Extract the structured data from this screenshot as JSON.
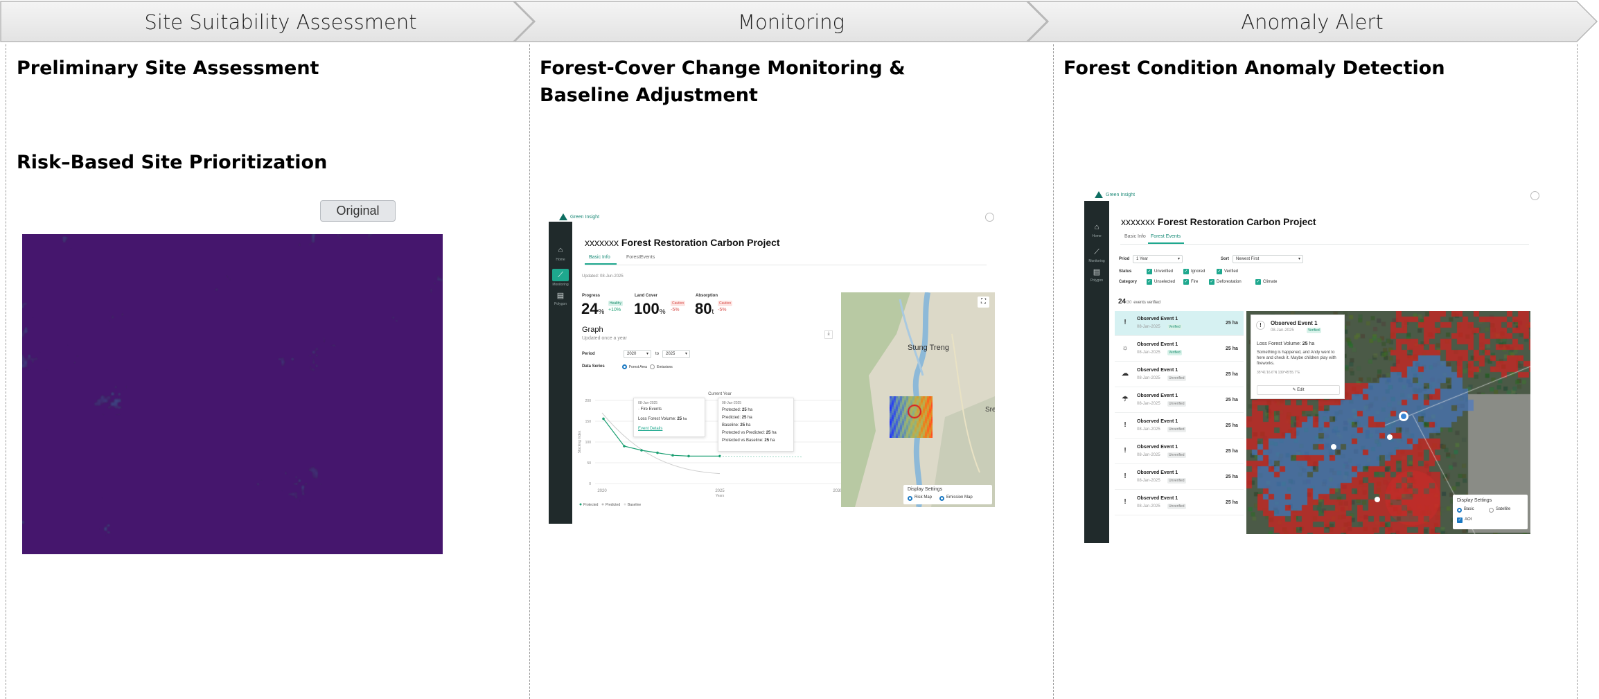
{
  "steps": [
    {
      "label": "Site Suitability Assessment"
    },
    {
      "label": "Monitoring"
    },
    {
      "label": "Anomaly Alert"
    }
  ],
  "col1": {
    "title1": "Preliminary Site Assessment",
    "title2": "Risk–Based Site Prioritization",
    "original_button": "Original"
  },
  "col2": {
    "title": "Forest-Cover Change Monitoring & Baseline Adjustment",
    "app": {
      "brand": "Green Insight",
      "nav": [
        {
          "label": "Home",
          "icon": "home-icon"
        },
        {
          "label": "Monitoring",
          "icon": "chart-icon"
        },
        {
          "label": "Polygon",
          "icon": "layers-icon"
        }
      ],
      "project_title_prefix": "xxxxxxx",
      "project_title": "Forest Restoration Carbon Project",
      "tabs": [
        "Basic Info",
        "ForestEvents"
      ],
      "updated": "Updated: 08-Jun-2025",
      "metrics": [
        {
          "label": "Progress",
          "value": "24",
          "unit": "%",
          "badge": "Healthy",
          "delta": "+10%",
          "tone": "green"
        },
        {
          "label": "Land Cover",
          "value": "100",
          "unit": "%",
          "badge": "Caution",
          "delta": "-5%",
          "tone": "red"
        },
        {
          "label": "Absorption",
          "value": "80",
          "unit": "t",
          "badge": "Caution",
          "delta": "-5%",
          "tone": "red"
        }
      ],
      "graph_title": "Graph",
      "graph_subtitle": "Updated once a year",
      "period_label": "Period",
      "period_from": "2020",
      "period_to_label": "to",
      "period_to": "2025",
      "data_series_label": "Data Series",
      "series_options": [
        "Forest Area",
        "Emissions"
      ],
      "chart_label_current": "Current Year",
      "y_axis_label": "Stocking Index",
      "x_axis_label": "Years",
      "y_ticks": [
        "200",
        "150",
        "100",
        "50",
        "0"
      ],
      "x_ticks": [
        "2020",
        "2025",
        "2030"
      ],
      "legend": [
        "Protected",
        "Predicted",
        "Baseline"
      ],
      "tooltip1": {
        "date": "08-Jan-2025",
        "event": "Fire Events",
        "volume_label": "Loss Forest Volume:",
        "volume_value": "25",
        "volume_unit": "ha",
        "link": "Event Details"
      },
      "tooltip2": {
        "date": "08-Jan-2025",
        "rows": [
          {
            "label": "Protected:",
            "value": "25",
            "unit": "ha"
          },
          {
            "label": "Predicted:",
            "value": "25",
            "unit": "ha"
          },
          {
            "label": "Baseline:",
            "value": "25",
            "unit": "ha"
          },
          {
            "label": "Protected vs Predicted:",
            "value": "25",
            "unit": "ha"
          },
          {
            "label": "Protected vs Baseline:",
            "value": "25",
            "unit": "ha"
          }
        ]
      },
      "map_label_town": "Stung Treng",
      "map_label_edge": "Sre",
      "display_settings": "Display Settings",
      "map_options": [
        "Risk Map",
        "Emission Map"
      ]
    }
  },
  "col3": {
    "title": "Forest Condition Anomaly Detection",
    "app": {
      "brand": "Green Insight",
      "nav": [
        {
          "label": "Home",
          "icon": "home-icon"
        },
        {
          "label": "Monitoring",
          "icon": "chart-icon"
        },
        {
          "label": "Polygon",
          "icon": "layers-icon"
        }
      ],
      "project_title_prefix": "xxxxxxx",
      "project_title": "Forest Restoration Carbon Project",
      "tabs": [
        "Basic Info",
        "Forest Events"
      ],
      "period_label": "Priod",
      "period_value": "1 Year",
      "sort_label": "Sort",
      "sort_value": "Newest First",
      "status_label": "Status",
      "status_options": [
        "Unverified",
        "Ignored",
        "Verified"
      ],
      "category_label": "Category",
      "category_options": [
        "Unselected",
        "Fire",
        "Deforestation",
        "Climate"
      ],
      "count_value": "24",
      "count_total": "/30",
      "count_suffix": "events verified",
      "events": [
        {
          "title": "Observed Event 1",
          "date": "08-Jan-2025",
          "status": "Verified",
          "value": "25 ha",
          "icon": "!",
          "icon_name": "alert-icon"
        },
        {
          "title": "Observed Event 1",
          "date": "08-Jan-2025",
          "status": "Verified",
          "value": "25 ha",
          "icon": "☼",
          "icon_name": "fire-icon"
        },
        {
          "title": "Observed Event 1",
          "date": "08-Jan-2025",
          "status": "Unverified",
          "value": "25 ha",
          "icon": "☁",
          "icon_name": "cloud-icon"
        },
        {
          "title": "Observed Event 1",
          "date": "08-Jan-2025",
          "status": "Unverified",
          "value": "25 ha",
          "icon": "☂",
          "icon_name": "storm-icon"
        },
        {
          "title": "Observed Event 1",
          "date": "08-Jan-2025",
          "status": "Unverified",
          "value": "25 ha",
          "icon": "!",
          "icon_name": "alert-icon"
        },
        {
          "title": "Observed Event 1",
          "date": "08-Jan-2025",
          "status": "Unverified",
          "value": "25 ha",
          "icon": "!",
          "icon_name": "alert-icon"
        },
        {
          "title": "Observed Event 1",
          "date": "08-Jan-2025",
          "status": "Unverified",
          "value": "25 ha",
          "icon": "!",
          "icon_name": "alert-icon"
        },
        {
          "title": "Observed Event 1",
          "date": "08-Jan-2025",
          "status": "Unverified",
          "value": "25 ha",
          "icon": "!",
          "icon_name": "alert-icon"
        }
      ],
      "popup": {
        "title": "Observed Event 1",
        "date": "08-Jan-2025",
        "status": "Verified",
        "volume_label": "Loss Forest Volume:",
        "volume_value": "25",
        "volume_unit": "ha",
        "note": "Something is happened, and Andy went to here and check it. Maybe children play with fireworks.",
        "coords": "35°41'16.6\"N 139°45'55.7\"E",
        "edit": "Edit"
      },
      "display_settings": "Display Settings",
      "map_options": [
        "Basic",
        "Satellite"
      ],
      "map_checkbox": "AOI"
    }
  },
  "colors": {
    "accent": "#1ea88e",
    "sidebar": "#202a2b",
    "viridis_low": "#45186d",
    "viridis_mid": "#21908d",
    "viridis_high": "#fde725"
  }
}
